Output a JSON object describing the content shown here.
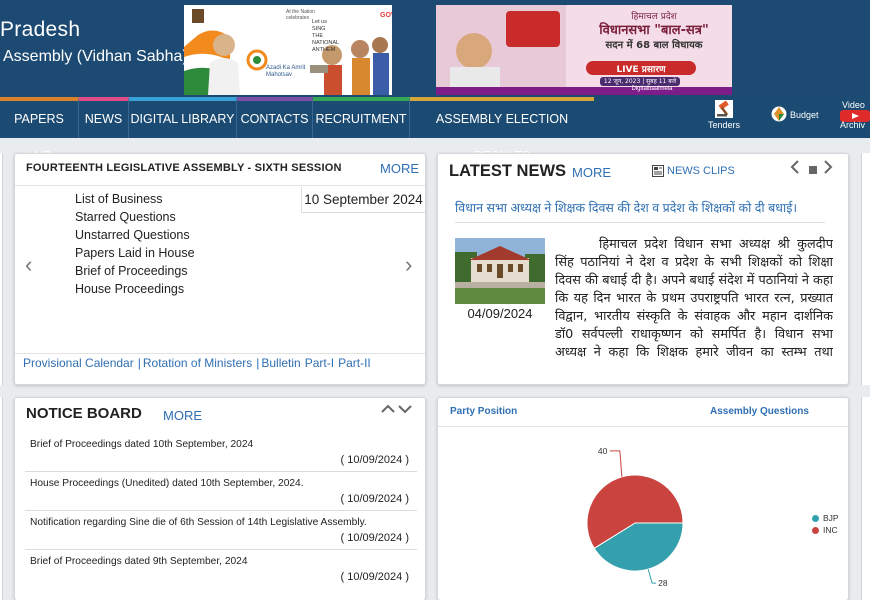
{
  "header": {
    "title": "Pradesh",
    "subtitle": "Assembly (Vidhan Sabha)",
    "banner_left": {
      "label_top": "At the Nation celebrates",
      "label_mid": "Let us SING THE NATIONAL ANTHEM",
      "label_brand": "Azadi Ka Amrit Mahotsav"
    },
    "banner_right": {
      "line1": "हिमाचल प्रदेश",
      "line2": "विधानसभा \"बाल-सत्र\"",
      "line3": "सदन में 68 बाल विधायक",
      "line4": "LIVE प्रसारण",
      "line5": "12 जून, 2023 | सुबह 11 बजे",
      "line6": "Digitalbaalmela"
    }
  },
  "nav": {
    "items": [
      {
        "label": "PAPERS LAID"
      },
      {
        "label": "NEWS"
      },
      {
        "label": "DIGITAL LIBRARY"
      },
      {
        "label": "CONTACTS"
      },
      {
        "label": "RECRUITMENT"
      },
      {
        "label": "ASSEMBLY ELECTION RESULTS"
      }
    ],
    "quick_links": [
      {
        "label": "Tenders",
        "icon": "gavel-icon"
      },
      {
        "label": "Budget",
        "icon": "budget-icon"
      },
      {
        "label": "Video Archive",
        "icon": "video-icon",
        "label_top": "Video",
        "label_bottom": "Archiv"
      }
    ]
  },
  "session": {
    "title": "FOURTEENTH LEGISLATIVE ASSEMBLY - SIXTH SESSION",
    "more": "MORE",
    "date": "10 September 2024",
    "items": [
      "List of Business",
      "Starred Questions",
      "Unstarred Questions",
      "Papers Laid in House",
      "Brief of Proceedings",
      "House Proceedings"
    ],
    "prev": "‹",
    "next": "›",
    "bottom_links": [
      "Provisional Calendar",
      "Rotation of Ministers",
      "Bulletin",
      "Part-I",
      "Part-II"
    ]
  },
  "news": {
    "title": "LATEST NEWS",
    "more": "MORE",
    "clips": "NEWS CLIPS",
    "headline": "विधान सभा अध्यक्ष ने शिक्षक दिवस की देश व प्रदेश के शिक्षकों को दी बधाई।",
    "date": "04/09/2024",
    "body": "हिमाचल प्रदेश विधान सभा अध्यक्ष श्री कुलदीप सिंह पठानियां ने देश व प्रदेश के सभी शिक्षकों को शिक्षा दिवस की बधाई दी है। अपने बधाई संदेश में पठानियां ने कहा कि यह दिन भारत के प्रथम उपराष्ट्रपति भारत रत्न, प्रख्यात विद्वान, भारतीय संस्कृति के संवाहक और महान दार्शनिक डॉ0 सर्वपल्ली राधाकृष्णन को समर्पित है। विधान सभा अध्यक्ष ने कहा कि शिक्षक हमारे जीवन का स्तम्भ तथा मार्गदर्शक होते हैं। वह"
  },
  "notice_board": {
    "title": "NOTICE BOARD",
    "more": "MORE",
    "items": [
      {
        "text": "Brief of Proceedings dated 10th September, 2024",
        "date": "( 10/09/2024 )"
      },
      {
        "text": "House Proceedings (Unedited) dated 10th September, 2024.",
        "date": "( 10/09/2024 )"
      },
      {
        "text": "Notification regarding Sine die of 6th Session of 14th Legislative Assembly.",
        "date": "( 10/09/2024 )"
      },
      {
        "text": "Brief of Proceedings dated 9th September, 2024",
        "date": "( 10/09/2024 )"
      }
    ]
  },
  "party": {
    "tab_party": "Party Position",
    "tab_questions": "Assembly Questions",
    "colors": {
      "BJP": "#34a0ae",
      "INC": "#c9443f"
    }
  },
  "chart_data": {
    "type": "pie",
    "title": "",
    "categories": [
      "BJP",
      "INC"
    ],
    "values": [
      28,
      40
    ],
    "data_labels": [
      "28",
      "40"
    ],
    "legend_position": "right"
  }
}
